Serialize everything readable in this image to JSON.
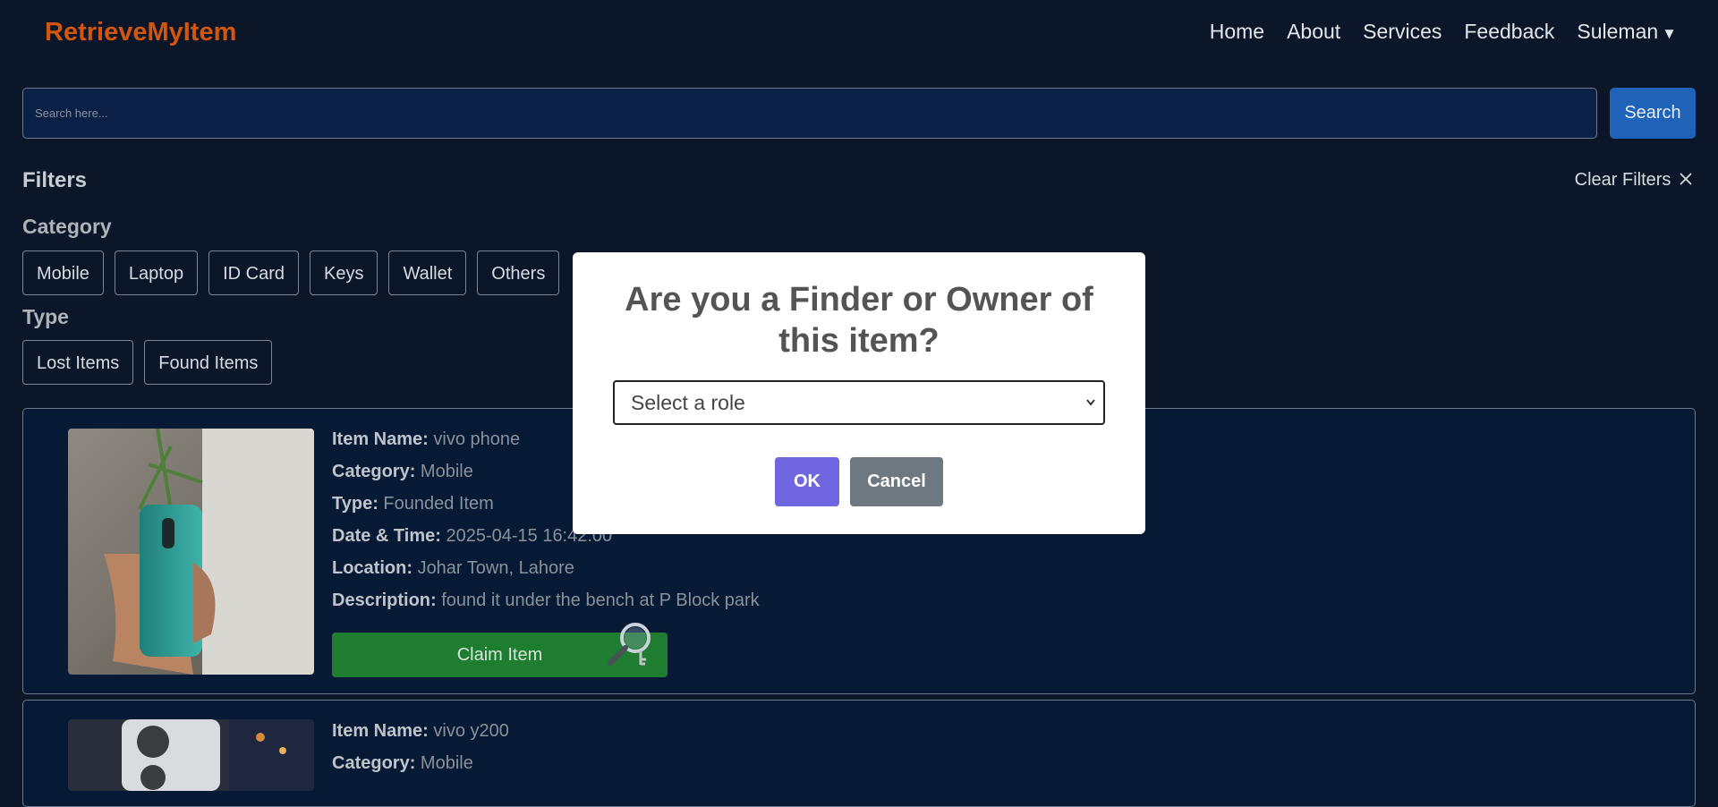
{
  "brand": "RetrieveMyItem",
  "nav": {
    "links": [
      "Home",
      "About",
      "Services",
      "Feedback"
    ],
    "user": "Suleman",
    "user_caret": "▼"
  },
  "search": {
    "placeholder": "Search here...",
    "button": "Search"
  },
  "filters": {
    "title": "Filters",
    "clear": "Clear Filters",
    "category_label": "Category",
    "categories": [
      "Mobile",
      "Laptop",
      "ID Card",
      "Keys",
      "Wallet",
      "Others"
    ],
    "type_label": "Type",
    "types": [
      "Lost Items",
      "Found Items"
    ]
  },
  "labels": {
    "item_name": "Item Name:",
    "category": "Category:",
    "type": "Type:",
    "datetime": "Date & Time:",
    "location": "Location:",
    "description": "Description:"
  },
  "items": [
    {
      "name": "vivo phone",
      "category": "Mobile",
      "type": "Founded Item",
      "datetime": "2025-04-15 16:42:00",
      "location": "Johar Town, Lahore",
      "description": "found it under the bench at P Block park",
      "button": "Claim Item"
    },
    {
      "name": "vivo y200",
      "category": "Mobile"
    }
  ],
  "modal": {
    "title": "Are you a Finder or Owner of this item?",
    "select_value": "Select a role",
    "ok": "OK",
    "cancel": "Cancel"
  },
  "colors": {
    "background": "#0b1628",
    "brand": "#d2560f",
    "search_button": "#1e63b8",
    "claim_button": "#1f7d32",
    "modal_ok": "#7066e0",
    "modal_cancel": "#6e7881"
  }
}
